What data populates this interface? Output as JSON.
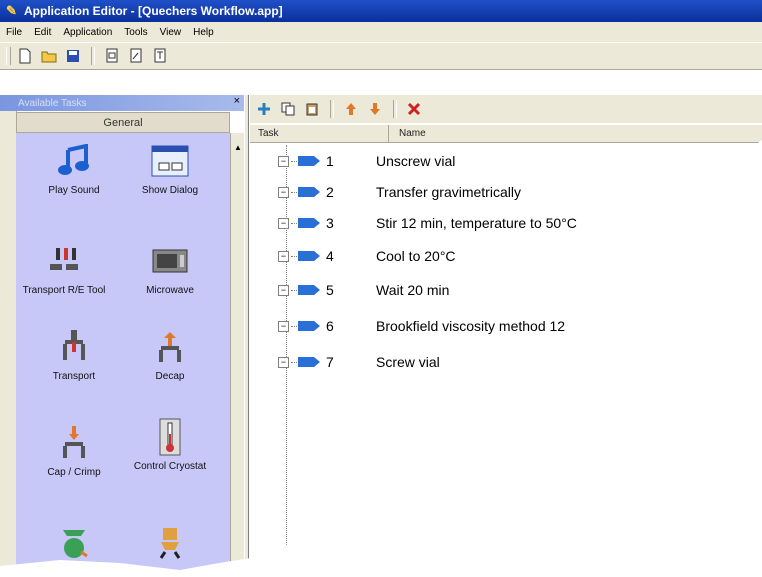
{
  "window": {
    "title": "Application Editor - [Quechers Workflow.app]"
  },
  "menu": [
    "File",
    "Edit",
    "Application",
    "Tools",
    "View",
    "Help"
  ],
  "left_panel": {
    "title": "Available Tasks",
    "close": "×",
    "group": "General",
    "tools": [
      {
        "label": "Play Sound",
        "icon": "music-note-icon"
      },
      {
        "label": "Show Dialog",
        "icon": "dialog-window-icon"
      },
      {
        "label": "Transport R/E Tool",
        "icon": "transport-tool-icon"
      },
      {
        "label": "Microwave",
        "icon": "microwave-icon"
      },
      {
        "label": "Transport",
        "icon": "transport-arm-icon"
      },
      {
        "label": "Decap",
        "icon": "decap-icon"
      },
      {
        "label": "Cap / Crimp",
        "icon": "cap-crimp-icon"
      },
      {
        "label": "Control Cryostat",
        "icon": "thermometer-icon"
      }
    ]
  },
  "task_list": {
    "columns": {
      "task": "Task",
      "name": "Name"
    },
    "rows": [
      {
        "task": "1",
        "name": "Unscrew vial"
      },
      {
        "task": "2",
        "name": "Transfer gravimetrically"
      },
      {
        "task": "3",
        "name": "Stir 12 min, temperature to 50°C"
      },
      {
        "task": "4",
        "name": "Cool to 20°C"
      },
      {
        "task": "5",
        "name": "Wait 20 min"
      },
      {
        "task": "6",
        "name": "Brookfield viscosity method 12"
      },
      {
        "task": "7",
        "name": "Screw vial"
      }
    ]
  },
  "colors": {
    "title_bar": "#0a2f9a",
    "palette_bg": "#c8c8f8",
    "chrome": "#ece9d8",
    "task_tag": "#2a6fd6"
  }
}
